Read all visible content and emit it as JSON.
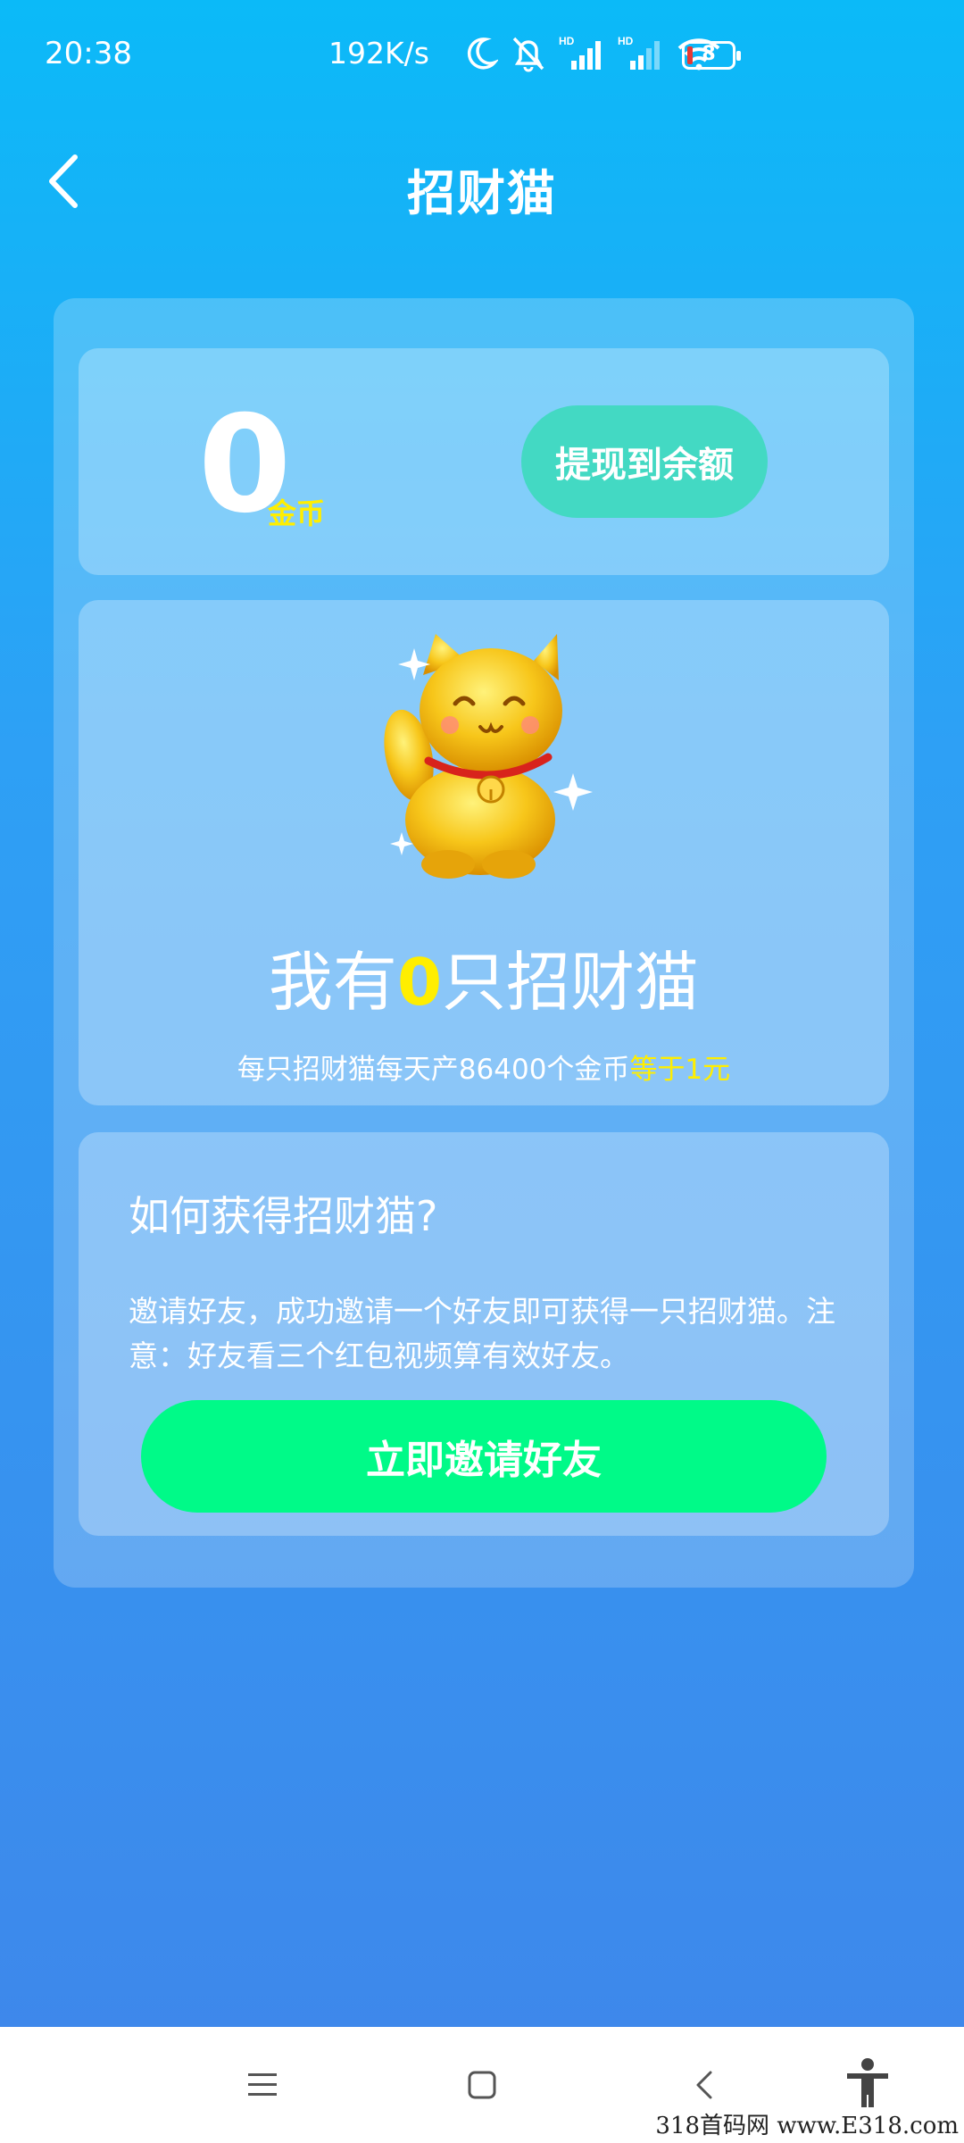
{
  "status_bar": {
    "time": "20:38",
    "network_speed": "192K/s",
    "battery_level": "8"
  },
  "header": {
    "title": "招财猫"
  },
  "balance": {
    "value": "0",
    "unit": "金币",
    "withdraw_label": "提现到余额"
  },
  "cat_card": {
    "prefix": "我有",
    "count": "0",
    "suffix": "只招财猫",
    "description": "每只招财猫每天产86400个金币",
    "description_highlight": "等于1元"
  },
  "how_to": {
    "title": "如何获得招财猫?",
    "text": "邀请好友，成功邀请一个好友即可获得一只招财猫。注意：好友看三个红包视频算有效好友。",
    "invite_label": "立即邀请好友"
  },
  "watermark": "318首码网 www.E318.com",
  "colors": {
    "accent_yellow": "#ffee00",
    "withdraw_button": "#43d9c3",
    "invite_button": "#00fa88"
  }
}
